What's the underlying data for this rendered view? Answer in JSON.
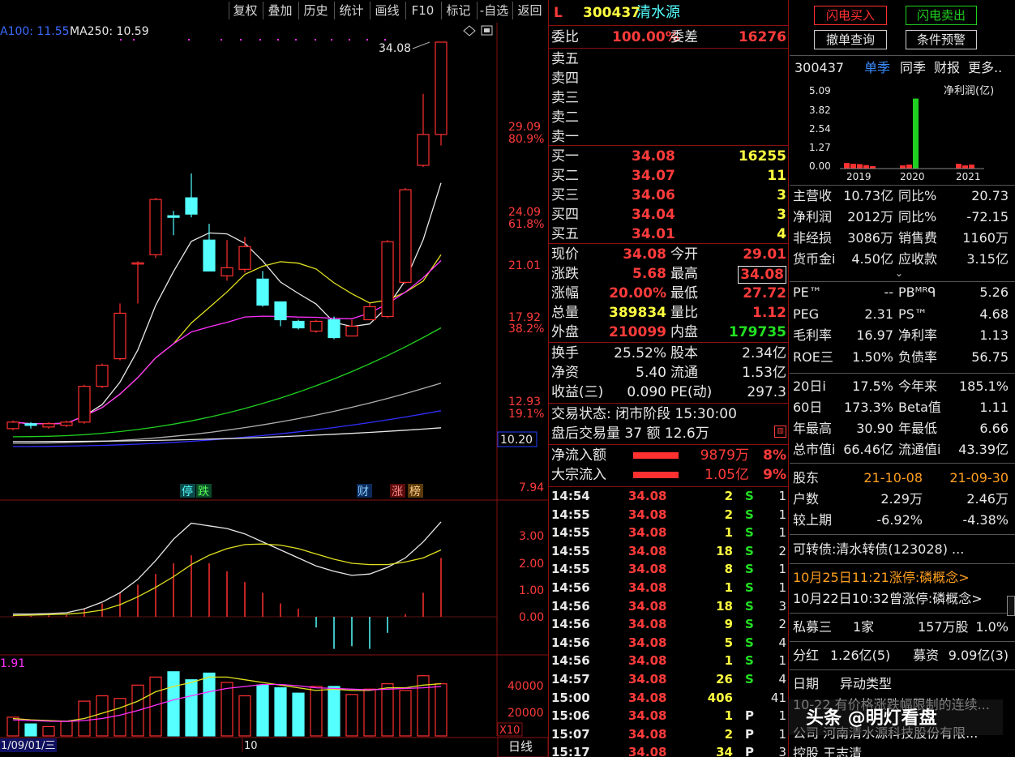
{
  "toolbar": {
    "buttons": [
      "复权",
      "叠加",
      "历史",
      "统计",
      "画线",
      "F10",
      "标记",
      "-自选",
      "返回"
    ]
  },
  "chart": {
    "ma_label_a": "A100: 11.55",
    "ma_label_b": "MA250: 10.59",
    "high_label": "34.08",
    "price_axis": [
      "29.09",
      "80.9%",
      "24.09",
      "61.8%",
      "21.01",
      "17.92",
      "38.2%",
      "12.93",
      "19.1%",
      "7.94"
    ],
    "current_price_box": "10.20",
    "event_markers": [
      "停",
      "跌",
      "财",
      "涨",
      "榜"
    ],
    "macd_axis": [
      "3.00",
      "2.00",
      "1.00",
      "0.00"
    ],
    "volume_label": "1.91",
    "volume_axis": [
      "40000",
      "20000"
    ],
    "volume_unit": "X10",
    "date_label": "1/09/01/三",
    "month_label": "10",
    "period_label": "日线",
    "colors": {
      "up": "#ff3030",
      "down": "#54ffff",
      "ma_white": "#e8e8e8",
      "ma_yellow": "#e0e020",
      "ma_magenta": "#ff30ff",
      "ma_green": "#20d020",
      "ma_gray": "#b0b0b0",
      "ma_blue": "#3030ff"
    }
  },
  "chart_data": {
    "type": "candlestick",
    "title": "",
    "candles": [
      {
        "o": 10.3,
        "c": 10.7,
        "h": 10.8,
        "l": 10.2
      },
      {
        "o": 10.6,
        "c": 10.5,
        "h": 10.7,
        "l": 10.3
      },
      {
        "o": 10.4,
        "c": 10.6,
        "h": 10.7,
        "l": 10.3
      },
      {
        "o": 10.5,
        "c": 10.7,
        "h": 10.8,
        "l": 10.4
      },
      {
        "o": 10.7,
        "c": 12.9,
        "h": 13.0,
        "l": 10.6
      },
      {
        "o": 12.9,
        "c": 14.2,
        "h": 14.3,
        "l": 12.8
      },
      {
        "o": 14.6,
        "c": 17.4,
        "h": 18.0,
        "l": 14.5
      },
      {
        "o": 20.5,
        "c": 20.5,
        "h": 20.6,
        "l": 18.0
      },
      {
        "o": 21.0,
        "c": 24.4,
        "h": 24.5,
        "l": 20.8
      },
      {
        "o": 23.4,
        "c": 23.3,
        "h": 23.7,
        "l": 22.2
      },
      {
        "o": 24.5,
        "c": 23.5,
        "h": 26.0,
        "l": 23.3
      },
      {
        "o": 21.9,
        "c": 20.0,
        "h": 22.9,
        "l": 20.0
      },
      {
        "o": 19.7,
        "c": 20.2,
        "h": 21.9,
        "l": 19.4
      },
      {
        "o": 20.1,
        "c": 21.5,
        "h": 22.1,
        "l": 19.9
      },
      {
        "o": 19.5,
        "c": 17.9,
        "h": 20.0,
        "l": 17.8
      },
      {
        "o": 18.1,
        "c": 17.0,
        "h": 18.1,
        "l": 16.6
      },
      {
        "o": 16.9,
        "c": 16.5,
        "h": 17.0,
        "l": 16.4
      },
      {
        "o": 16.3,
        "c": 16.9,
        "h": 17.0,
        "l": 16.2
      },
      {
        "o": 17.0,
        "c": 15.9,
        "h": 17.2,
        "l": 15.8
      },
      {
        "o": 16.0,
        "c": 16.6,
        "h": 17.0,
        "l": 16.0
      },
      {
        "o": 17.0,
        "c": 17.8,
        "h": 18.0,
        "l": 17.0
      },
      {
        "o": 17.2,
        "c": 21.8,
        "h": 21.9,
        "l": 17.1
      },
      {
        "o": 19.3,
        "c": 25.0,
        "h": 25.1,
        "l": 19.2
      },
      {
        "o": 26.5,
        "c": 28.4,
        "h": 30.9,
        "l": 26.4
      },
      {
        "o": 28.4,
        "c": 34.08,
        "h": 34.08,
        "l": 27.72
      }
    ]
  },
  "quote": {
    "market_tag": "L",
    "code": "300437",
    "name": "清水源",
    "weibi_label": "委比",
    "weibi_value": "100.00%",
    "weicha_label": "委差",
    "weicha_value": "16276",
    "sell": [
      {
        "label": "卖五"
      },
      {
        "label": "卖四"
      },
      {
        "label": "卖三"
      },
      {
        "label": "卖二"
      },
      {
        "label": "卖一"
      }
    ],
    "buy": [
      {
        "label": "买一",
        "price": "34.08",
        "vol": "16255"
      },
      {
        "label": "买二",
        "price": "34.07",
        "vol": "11"
      },
      {
        "label": "买三",
        "price": "34.06",
        "vol": "3"
      },
      {
        "label": "买四",
        "price": "34.04",
        "vol": "3"
      },
      {
        "label": "买五",
        "price": "34.01",
        "vol": "4"
      }
    ],
    "stats": [
      {
        "l1": "现价",
        "v1": "34.08",
        "l2": "今开",
        "v2": "29.01",
        "c1": "red",
        "c2": "red"
      },
      {
        "l1": "涨跌",
        "v1": "5.68",
        "l2": "最高",
        "v2": "34.08",
        "c1": "red",
        "c2": "red"
      },
      {
        "l1": "涨幅",
        "v1": "20.00%",
        "l2": "最低",
        "v2": "27.72",
        "c1": "red",
        "c2": "red"
      },
      {
        "l1": "总量",
        "v1": "389834",
        "l2": "量比",
        "v2": "1.12",
        "c1": "yellow",
        "c2": "red"
      },
      {
        "l1": "外盘",
        "v1": "210099",
        "l2": "内盘",
        "v2": "179735",
        "c1": "red",
        "c2": "green"
      }
    ],
    "stats2": [
      {
        "l1": "换手",
        "v1": "25.52%",
        "l2": "股本",
        "v2": "2.34亿"
      },
      {
        "l1": "净资",
        "v1": "5.40",
        "l2": "流通",
        "v2": "1.53亿"
      },
      {
        "l1": "收益(三)",
        "v1": "0.090",
        "l2": "PE(动)",
        "v2": "297.3"
      }
    ],
    "trade_status": "交易状态: 闭市阶段 15:30:00",
    "after_hours": "盘后交易量 37 额 12.6万",
    "flow": [
      {
        "label": "净流入额",
        "value": "9879万",
        "pct": "8%"
      },
      {
        "label": "大宗流入",
        "value": "1.05亿",
        "pct": "9%"
      }
    ],
    "ticks": [
      {
        "t": "14:54",
        "p": "34.08",
        "v": "2",
        "s": "S",
        "n": "1"
      },
      {
        "t": "14:55",
        "p": "34.08",
        "v": "2",
        "s": "S",
        "n": "1"
      },
      {
        "t": "14:55",
        "p": "34.08",
        "v": "1",
        "s": "S",
        "n": "1"
      },
      {
        "t": "14:55",
        "p": "34.08",
        "v": "18",
        "s": "S",
        "n": "2"
      },
      {
        "t": "14:55",
        "p": "34.08",
        "v": "8",
        "s": "S",
        "n": "1"
      },
      {
        "t": "14:56",
        "p": "34.08",
        "v": "1",
        "s": "S",
        "n": "1"
      },
      {
        "t": "14:56",
        "p": "34.08",
        "v": "18",
        "s": "S",
        "n": "3"
      },
      {
        "t": "14:56",
        "p": "34.08",
        "v": "9",
        "s": "S",
        "n": "2"
      },
      {
        "t": "14:56",
        "p": "34.08",
        "v": "5",
        "s": "S",
        "n": "4"
      },
      {
        "t": "14:56",
        "p": "34.08",
        "v": "1",
        "s": "S",
        "n": "1"
      },
      {
        "t": "14:57",
        "p": "34.08",
        "v": "26",
        "s": "S",
        "n": "4"
      },
      {
        "t": "15:00",
        "p": "34.08",
        "v": "406",
        "s": "",
        "n": "41"
      },
      {
        "t": "15:06",
        "p": "34.08",
        "v": "1",
        "s": "P",
        "n": "1"
      },
      {
        "t": "15:07",
        "p": "34.08",
        "v": "2",
        "s": "P",
        "n": "1"
      },
      {
        "t": "15:17",
        "p": "34.08",
        "v": "34",
        "s": "P",
        "n": "3"
      }
    ]
  },
  "side": {
    "flash_buy": "闪电买入",
    "flash_sell": "闪电卖出",
    "cancel_query": "撤单查询",
    "condition_alert": "条件预警",
    "code": "300437",
    "tabs": [
      "单季",
      "同季",
      "财报",
      "更多.."
    ],
    "profit_chart": {
      "title": "净利润(亿)",
      "yaxis": [
        "5.09",
        "3.82",
        "2.54",
        "1.27",
        "0.00"
      ],
      "years": [
        "2019",
        "2020",
        "2021"
      ],
      "values": [
        0.35,
        0.3,
        0.28,
        0.22,
        0.15,
        0.2,
        0.25,
        4.4,
        0.3,
        0.2,
        0.25
      ]
    },
    "fin": [
      {
        "l1": "主营收",
        "v1": "10.73亿",
        "l2": "同比%",
        "v2": "20.73"
      },
      {
        "l1": "净利润",
        "v1": "2012万",
        "l2": "同比%",
        "v2": "-72.15"
      },
      {
        "l1": "非经损",
        "v1": "3086万",
        "l2": "销售费",
        "v2": "1160万"
      },
      {
        "l1": "货币金i",
        "v1": "4.50亿",
        "l2": "应收款",
        "v2": "3.15亿"
      }
    ],
    "valuation": [
      {
        "l1": "PE™",
        "v1": "--",
        "l2": "PBᴹᴿᑫ",
        "v2": "5.26"
      },
      {
        "l1": "PEG",
        "v1": "2.31",
        "l2": "PS™",
        "v2": "4.68"
      },
      {
        "l1": "毛利率",
        "v1": "16.97",
        "l2": "净利率",
        "v2": "1.13"
      },
      {
        "l1": "ROE三",
        "v1": "1.50%",
        "l2": "负债率",
        "v2": "56.75"
      }
    ],
    "perf": [
      {
        "l1": "20日i",
        "v1": "17.5%",
        "l2": "今年来",
        "v2": "185.1%"
      },
      {
        "l1": "60日",
        "v1": "173.3%",
        "l2": "Beta值",
        "v2": "1.11"
      },
      {
        "l1": "年最高",
        "v1": "30.90",
        "l2": "年最低",
        "v2": "6.66"
      },
      {
        "l1": "总市值i",
        "v1": "66.46亿",
        "l2": "流通值i",
        "v2": "43.39亿"
      }
    ],
    "holders": [
      {
        "l": "股东",
        "a": "21-10-08",
        "b": "21-09-30"
      },
      {
        "l": "户数",
        "a": "2.29万",
        "b": "2.46万"
      },
      {
        "l": "较上期",
        "a": "-6.92%",
        "b": "-4.38%"
      }
    ],
    "convertible": "可转债:清水转债(123028) ...",
    "news1": "10月25日11:21涨停:磷概念>",
    "news2": "10月22日10:32曾涨停:磷概念>",
    "placement": {
      "l": "私募三",
      "a": "1家",
      "b": "157万股",
      "c": "1.0%"
    },
    "dividend": {
      "l": "分红",
      "a": "1.26亿(5)",
      "l2": "募资",
      "b": "9.09亿(3)"
    },
    "event_header": {
      "l": "日期",
      "r": "异动类型"
    },
    "event_row": "10-22 有价格涨跌幅限制的连续...",
    "company_row": "公司 河南清水源科技股份有限...",
    "holder_row": "控股 王志清"
  },
  "watermark": "头条 @明灯看盘"
}
